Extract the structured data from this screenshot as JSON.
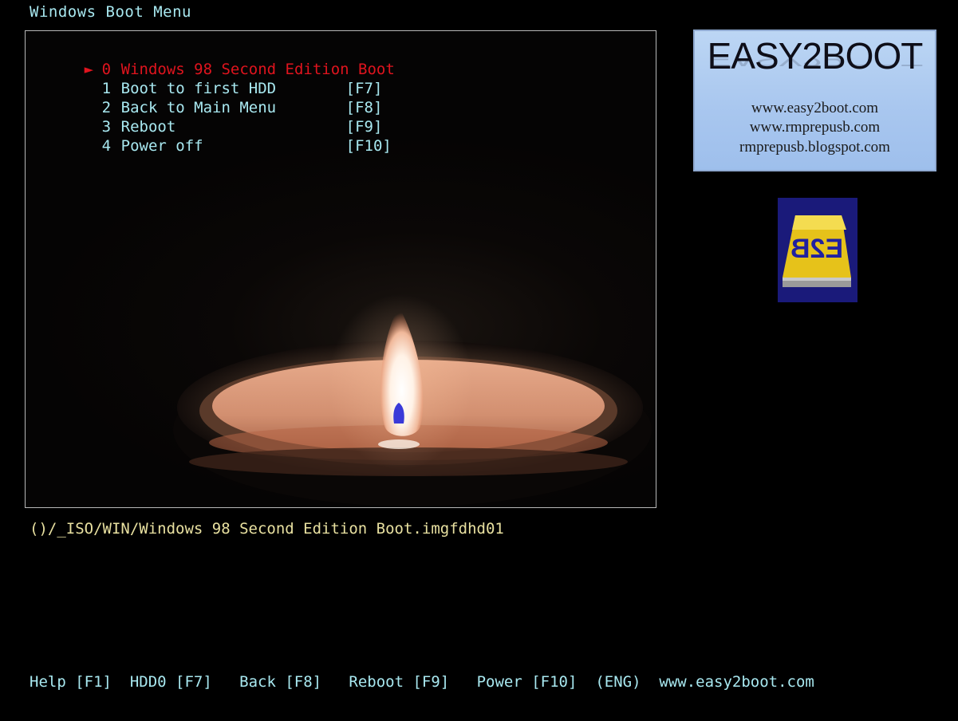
{
  "window": {
    "title": "Windows Boot Menu"
  },
  "menu": {
    "items": [
      {
        "num": "0",
        "label": "Windows 98 Second Edition Boot",
        "key": "",
        "selected": true
      },
      {
        "num": "1",
        "label": "Boot to first HDD",
        "key": "[F7]",
        "selected": false
      },
      {
        "num": "2",
        "label": "Back to Main Menu",
        "key": "[F8]",
        "selected": false
      },
      {
        "num": "3",
        "label": "Reboot",
        "key": "[F9]",
        "selected": false
      },
      {
        "num": "4",
        "label": "Power off",
        "key": "[F10]",
        "selected": false
      }
    ],
    "selection_arrow": "►"
  },
  "status": {
    "path": "()/_ISO/WIN/Windows 98 Second Edition Boot.imgfdhd01"
  },
  "footer": {
    "items": [
      {
        "text": "Help [F1]"
      },
      {
        "text": "HDD0 [F7]"
      },
      {
        "text": "Back [F8]"
      },
      {
        "text": "Reboot [F9]"
      },
      {
        "text": "Power [F10]"
      },
      {
        "text": "(ENG)"
      },
      {
        "text": "www.easy2boot.com"
      }
    ]
  },
  "logo": {
    "title": "EASY2BOOT",
    "urls": [
      "www.easy2boot.com",
      "www.rmprepusb.com",
      "rmprepusb.blogspot.com"
    ]
  },
  "icon": {
    "name": "e2b-drive-icon",
    "text": "E2B"
  },
  "colors": {
    "background": "#000000",
    "text": "#a8e8f0",
    "selected": "#e0141e",
    "path": "#e8e0a0",
    "logo_bg": "#a9c7ef"
  }
}
